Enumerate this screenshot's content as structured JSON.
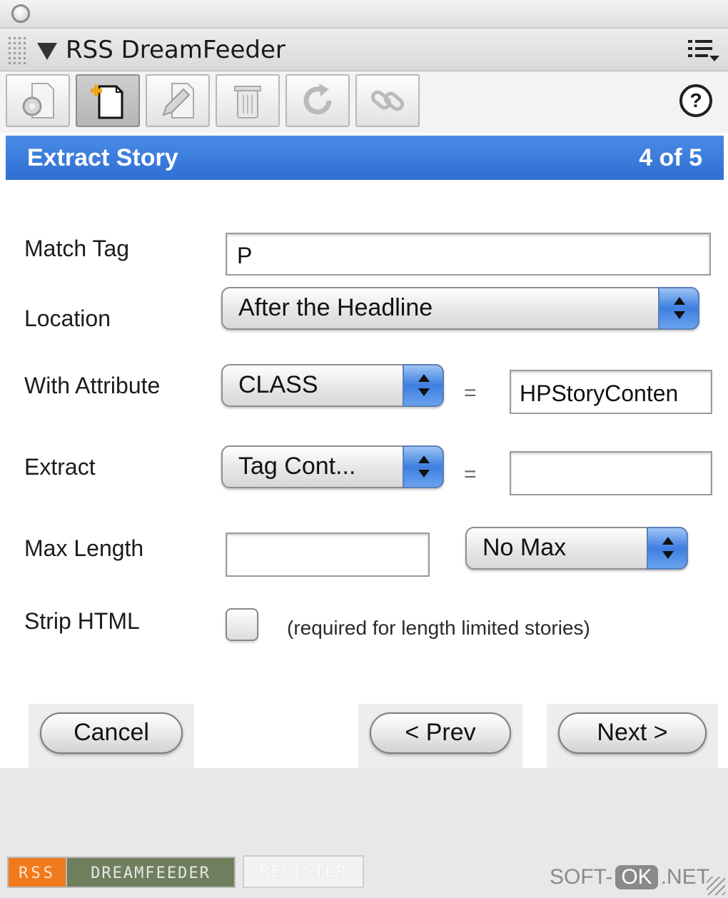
{
  "panel": {
    "title": "RSS DreamFeeder"
  },
  "toolbar": {
    "tools": [
      {
        "icon": "settings-document-icon"
      },
      {
        "icon": "new-document-icon"
      },
      {
        "icon": "edit-document-icon"
      },
      {
        "icon": "trash-icon"
      },
      {
        "icon": "refresh-icon"
      },
      {
        "icon": "link-icon"
      }
    ],
    "help_label": "?"
  },
  "step": {
    "title": "Extract Story",
    "progress": "4 of 5"
  },
  "form": {
    "match_tag": {
      "label": "Match Tag",
      "value": "P"
    },
    "location": {
      "label": "Location",
      "value": "After the Headline"
    },
    "with_attribute": {
      "label": "With Attribute",
      "select_value": "CLASS",
      "equals": "=",
      "value": "HPStoryConten"
    },
    "extract": {
      "label": "Extract",
      "select_value": "Tag Cont...",
      "equals": "=",
      "value": ""
    },
    "max_length": {
      "label": "Max Length",
      "value": "",
      "select_value": "No Max"
    },
    "strip_html": {
      "label": "Strip HTML",
      "checked": false,
      "hint": "(required for length limited stories)"
    }
  },
  "buttons": {
    "cancel": "Cancel",
    "prev": "< Prev",
    "next": "Next >"
  },
  "footer": {
    "logo_rss": "RSS",
    "logo_name": "DREAMFEEDER",
    "register": "REGISTER",
    "watermark_left": "SOFT-",
    "watermark_ok": "OK",
    "watermark_right": ".NET"
  },
  "colors": {
    "step_bar": "#3a7ad9",
    "popup_arrows": "#3d7ee0",
    "rss_orange": "#f07a1e"
  }
}
